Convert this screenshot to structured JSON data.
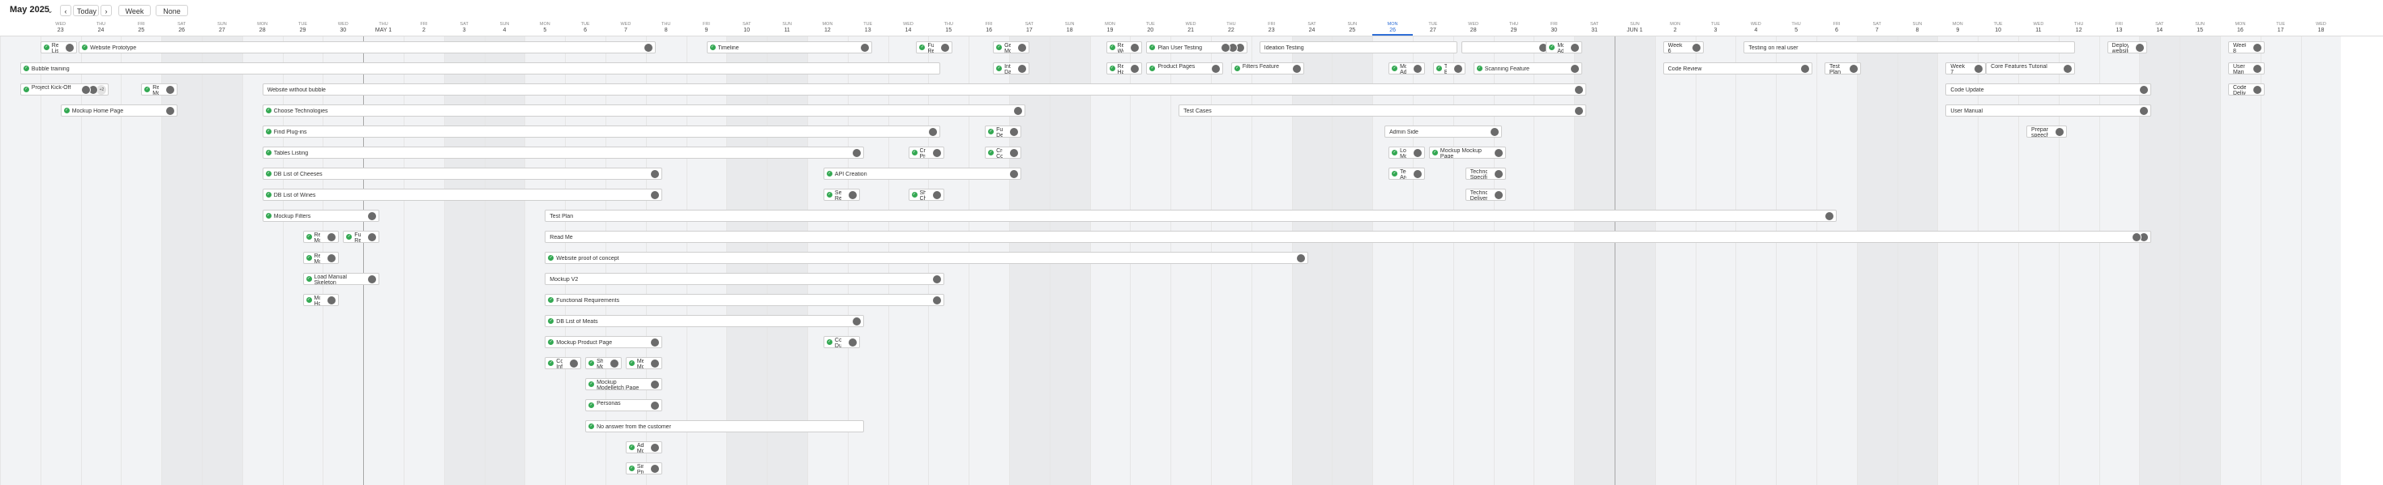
{
  "toolbar": {
    "month": "May 2025",
    "prev": "‹",
    "today": "Today",
    "next": "›",
    "scale": "Week",
    "grouping": "None"
  },
  "colors": {
    "accent": "#2f6fd6",
    "done": "#33a852",
    "weekend": "#e9eaec"
  },
  "days": [
    [
      "",
      "",
      ""
    ],
    [
      "WED",
      "23",
      ""
    ],
    [
      "THU",
      "24",
      ""
    ],
    [
      "FRI",
      "25",
      ""
    ],
    [
      "SAT",
      "26",
      "we"
    ],
    [
      "SUN",
      "27",
      "we"
    ],
    [
      "MON",
      "28",
      ""
    ],
    [
      "TUE",
      "29",
      ""
    ],
    [
      "WED",
      "30",
      ""
    ],
    [
      "THU",
      "MAY 1",
      "sep"
    ],
    [
      "FRI",
      "2",
      ""
    ],
    [
      "SAT",
      "3",
      "we"
    ],
    [
      "SUN",
      "4",
      "we"
    ],
    [
      "MON",
      "5",
      ""
    ],
    [
      "TUE",
      "6",
      ""
    ],
    [
      "WED",
      "7",
      ""
    ],
    [
      "THU",
      "8",
      ""
    ],
    [
      "FRI",
      "9",
      ""
    ],
    [
      "SAT",
      "10",
      "we"
    ],
    [
      "SUN",
      "11",
      "we"
    ],
    [
      "MON",
      "12",
      ""
    ],
    [
      "TUE",
      "13",
      ""
    ],
    [
      "WED",
      "14",
      ""
    ],
    [
      "THU",
      "15",
      ""
    ],
    [
      "FRI",
      "16",
      ""
    ],
    [
      "SAT",
      "17",
      "we"
    ],
    [
      "SUN",
      "18",
      "we"
    ],
    [
      "MON",
      "19",
      ""
    ],
    [
      "TUE",
      "20",
      ""
    ],
    [
      "WED",
      "21",
      ""
    ],
    [
      "THU",
      "22",
      ""
    ],
    [
      "FRI",
      "23",
      ""
    ],
    [
      "SAT",
      "24",
      "we"
    ],
    [
      "SUN",
      "25",
      "we"
    ],
    [
      "MON",
      "26",
      "today"
    ],
    [
      "TUE",
      "27",
      ""
    ],
    [
      "WED",
      "28",
      ""
    ],
    [
      "THU",
      "29",
      ""
    ],
    [
      "FRI",
      "30",
      ""
    ],
    [
      "SAT",
      "31",
      "we"
    ],
    [
      "SUN",
      "JUN 1",
      "wesep"
    ],
    [
      "MON",
      "2",
      ""
    ],
    [
      "TUE",
      "3",
      ""
    ],
    [
      "WED",
      "4",
      ""
    ],
    [
      "THU",
      "5",
      ""
    ],
    [
      "FRI",
      "6",
      ""
    ],
    [
      "SAT",
      "7",
      "we"
    ],
    [
      "SUN",
      "8",
      "we"
    ],
    [
      "MON",
      "9",
      ""
    ],
    [
      "TUE",
      "10",
      ""
    ],
    [
      "WED",
      "11",
      ""
    ],
    [
      "THU",
      "12",
      ""
    ],
    [
      "FRI",
      "13",
      ""
    ],
    [
      "SAT",
      "14",
      "we"
    ],
    [
      "SUN",
      "15",
      "we"
    ],
    [
      "MON",
      "16",
      ""
    ],
    [
      "TUE",
      "17",
      ""
    ],
    [
      "WED",
      "18",
      ""
    ]
  ],
  "tasks": [
    {
      "label": "Requi List",
      "c": 1.0,
      "w": 0.9,
      "r": 0,
      "av": 1
    },
    {
      "label": "Website Prototype",
      "c": 1.95,
      "w": 14.3,
      "r": 0,
      "av": 1
    },
    {
      "label": "Timeline",
      "c": 17.5,
      "w": 4.1,
      "r": 0,
      "av": 1
    },
    {
      "label": "Fund. Requi",
      "c": 22.7,
      "w": 0.9,
      "r": 0,
      "av": 1
    },
    {
      "label": "Gene Mock",
      "c": 24.6,
      "w": 0.9,
      "r": 0,
      "av": 1
    },
    {
      "label": "Requi Website",
      "c": 27.4,
      "w": 0.9,
      "r": 0,
      "av": 1
    },
    {
      "label": "Plan User Testing",
      "c": 28.4,
      "w": 2.5,
      "r": 0,
      "av": 3
    },
    {
      "label": "Ideation Testing",
      "c": 31.2,
      "w": 4.9,
      "r": 0,
      "av": 0,
      "nochk": true
    },
    {
      "label": "",
      "c": 36.2,
      "w": 2.6,
      "r": 0,
      "av": 2,
      "more": "+3",
      "nochk": true
    },
    {
      "label": "Mock Admi",
      "c": 38.3,
      "w": 0.9,
      "r": 0,
      "av": 1
    },
    {
      "label": "Week 6",
      "c": 41.2,
      "w": 1.0,
      "r": 0,
      "av": 1,
      "nochk": true
    },
    {
      "label": "Testing on real user",
      "c": 43.2,
      "w": 8.2,
      "r": 0,
      "av": 0,
      "nochk": true
    },
    {
      "label": "Deploy website",
      "c": 52.2,
      "w": 1.0,
      "r": 0,
      "av": 1,
      "nochk": true
    },
    {
      "label": "Week 8",
      "c": 55.2,
      "w": 0.9,
      "r": 0,
      "av": 1,
      "nochk": true
    },
    {
      "label": "Bubble training",
      "c": 0.5,
      "w": 22.8,
      "r": 1,
      "av": 0
    },
    {
      "label": "Integ Dashb",
      "c": 24.6,
      "w": 0.9,
      "r": 1,
      "av": 1
    },
    {
      "label": "Requi Hand",
      "c": 27.4,
      "w": 0.9,
      "r": 1,
      "av": 1
    },
    {
      "label": "Product Pages",
      "c": 28.4,
      "w": 1.9,
      "r": 1,
      "av": 1
    },
    {
      "label": "Filters Feature",
      "c": 30.5,
      "w": 1.8,
      "r": 1,
      "av": 1
    },
    {
      "label": "Mock Ad",
      "c": 34.4,
      "w": 0.9,
      "r": 1,
      "av": 1
    },
    {
      "label": "Testing Bar",
      "c": 35.5,
      "w": 0.8,
      "r": 1,
      "av": 1
    },
    {
      "label": "Scanning Feature",
      "c": 36.5,
      "w": 2.7,
      "r": 1,
      "av": 1
    },
    {
      "label": "Code Review",
      "c": 41.2,
      "w": 3.7,
      "r": 1,
      "av": 1,
      "nochk": true
    },
    {
      "label": "Test Plan",
      "c": 45.2,
      "w": 0.9,
      "r": 1,
      "av": 1,
      "nochk": true
    },
    {
      "label": "Week 7",
      "c": 48.2,
      "w": 1.0,
      "r": 1,
      "av": 1,
      "nochk": true
    },
    {
      "label": "Core Features Tutorial",
      "c": 49.2,
      "w": 2.2,
      "r": 1,
      "av": 1,
      "nochk": true
    },
    {
      "label": "User Man",
      "c": 55.2,
      "w": 0.9,
      "r": 1,
      "av": 1,
      "nochk": true
    },
    {
      "label": "Project Kick-Off",
      "c": 0.5,
      "w": 2.2,
      "r": 2,
      "av": 2,
      "more": "+2"
    },
    {
      "label": "Requi Mock",
      "c": 3.5,
      "w": 0.9,
      "r": 2,
      "av": 1
    },
    {
      "label": "Website without bubble",
      "c": 6.5,
      "w": 32.8,
      "r": 2,
      "av": 1,
      "nochk": true
    },
    {
      "label": "Code Update",
      "c": 48.2,
      "w": 5.1,
      "r": 2,
      "av": 1,
      "nochk": true
    },
    {
      "label": "Code Deliver",
      "c": 55.2,
      "w": 0.9,
      "r": 2,
      "av": 1,
      "nochk": true
    },
    {
      "label": "Mockup Home Page",
      "c": 1.5,
      "w": 2.9,
      "r": 3,
      "av": 1
    },
    {
      "label": "Choose Technologies",
      "c": 6.5,
      "w": 18.9,
      "r": 3,
      "av": 1
    },
    {
      "label": "Test Cases",
      "c": 29.2,
      "w": 10.1,
      "r": 3,
      "av": 1,
      "nochk": true
    },
    {
      "label": "User Manual",
      "c": 48.2,
      "w": 5.1,
      "r": 3,
      "av": 1,
      "nochk": true
    },
    {
      "label": "Find Plug-ins",
      "c": 6.5,
      "w": 16.8,
      "r": 4,
      "av": 1
    },
    {
      "label": "Funct Delivery",
      "c": 24.4,
      "w": 0.9,
      "r": 4,
      "av": 1
    },
    {
      "label": "Admin Side",
      "c": 34.3,
      "w": 2.9,
      "r": 4,
      "av": 1,
      "nochk": true
    },
    {
      "label": "Prepare speech",
      "c": 50.2,
      "w": 1.0,
      "r": 4,
      "av": 1,
      "nochk": true
    },
    {
      "label": "Tables Listing",
      "c": 6.5,
      "w": 14.9,
      "r": 5,
      "av": 1
    },
    {
      "label": "Crea Prod",
      "c": 22.5,
      "w": 0.9,
      "r": 5,
      "av": 1
    },
    {
      "label": "Crea Conso",
      "c": 24.4,
      "w": 0.9,
      "r": 5,
      "av": 1
    },
    {
      "label": "Logo Mockup",
      "c": 34.4,
      "w": 0.9,
      "r": 5,
      "av": 1
    },
    {
      "label": "Mockup Mockup Page",
      "c": 35.4,
      "w": 1.9,
      "r": 5,
      "av": 1
    },
    {
      "label": "DB List of Cheeses",
      "c": 6.5,
      "w": 9.9,
      "r": 6,
      "av": 1
    },
    {
      "label": "API Creation",
      "c": 20.4,
      "w": 4.9,
      "r": 6,
      "av": 1
    },
    {
      "label": "Techn Archi",
      "c": 34.4,
      "w": 0.9,
      "r": 6,
      "av": 1
    },
    {
      "label": "Techno Specific",
      "c": 36.3,
      "w": 1.0,
      "r": 6,
      "av": 1,
      "nochk": true
    },
    {
      "label": "DB List of Wines",
      "c": 6.5,
      "w": 9.9,
      "r": 7,
      "av": 1
    },
    {
      "label": "Sea Resul",
      "c": 20.4,
      "w": 0.9,
      "r": 7,
      "av": 1
    },
    {
      "label": "Shop Chec",
      "c": 22.5,
      "w": 0.9,
      "r": 7,
      "av": 1
    },
    {
      "label": "Technol Delivery",
      "c": 36.3,
      "w": 1.0,
      "r": 7,
      "av": 1,
      "nochk": true
    },
    {
      "label": "Mockup Filters",
      "c": 6.5,
      "w": 2.9,
      "r": 8,
      "av": 1
    },
    {
      "label": "Test Plan",
      "c": 13.5,
      "w": 32.0,
      "r": 8,
      "av": 1,
      "nochk": true
    },
    {
      "label": "Regi Mock",
      "c": 7.5,
      "w": 0.9,
      "r": 9,
      "av": 1
    },
    {
      "label": "Fun Reco",
      "c": 8.5,
      "w": 0.9,
      "r": 9,
      "av": 1
    },
    {
      "label": "Read Me",
      "c": 13.5,
      "w": 39.8,
      "r": 9,
      "av": 2,
      "nochk": true
    },
    {
      "label": "Requ Mock",
      "c": 7.5,
      "w": 0.9,
      "r": 10,
      "av": 1
    },
    {
      "label": "Website proof of concept",
      "c": 13.5,
      "w": 18.9,
      "r": 10,
      "av": 1
    },
    {
      "label": "Load Manual Skeleton",
      "c": 7.5,
      "w": 1.9,
      "r": 11,
      "av": 1
    },
    {
      "label": "Mockup V2",
      "c": 13.5,
      "w": 9.9,
      "r": 11,
      "av": 1,
      "nochk": true
    },
    {
      "label": "Mock Hom",
      "c": 7.5,
      "w": 0.9,
      "r": 12,
      "av": 1
    },
    {
      "label": "Functional Requirements",
      "c": 13.5,
      "w": 9.9,
      "r": 12,
      "av": 1
    },
    {
      "label": "DB List of Meats",
      "c": 13.5,
      "w": 7.9,
      "r": 13,
      "av": 1
    },
    {
      "label": "Mockup Product Page",
      "c": 13.5,
      "w": 2.9,
      "r": 14,
      "av": 1
    },
    {
      "label": "Code Dummy",
      "c": 20.4,
      "w": 0.9,
      "r": 14,
      "av": 1
    },
    {
      "label": "Collect Informat",
      "c": 13.5,
      "w": 0.9,
      "r": 15,
      "av": 1
    },
    {
      "label": "Shop Mockup",
      "c": 14.5,
      "w": 0.9,
      "r": 15,
      "av": 1
    },
    {
      "label": "Ment Mockup",
      "c": 15.5,
      "w": 0.9,
      "r": 15,
      "av": 1
    },
    {
      "label": "Mockup Modelletch Page",
      "c": 14.5,
      "w": 1.9,
      "r": 16,
      "av": 1
    },
    {
      "label": "Personas",
      "c": 14.5,
      "w": 1.9,
      "r": 17,
      "av": 1
    },
    {
      "label": "No answer from the customer",
      "c": 14.5,
      "w": 6.9,
      "r": 18,
      "av": 0
    },
    {
      "label": "Add Mockup",
      "c": 15.5,
      "w": 0.9,
      "r": 19,
      "av": 1
    },
    {
      "label": "Single Product",
      "c": 15.5,
      "w": 0.9,
      "r": 20,
      "av": 1
    }
  ]
}
